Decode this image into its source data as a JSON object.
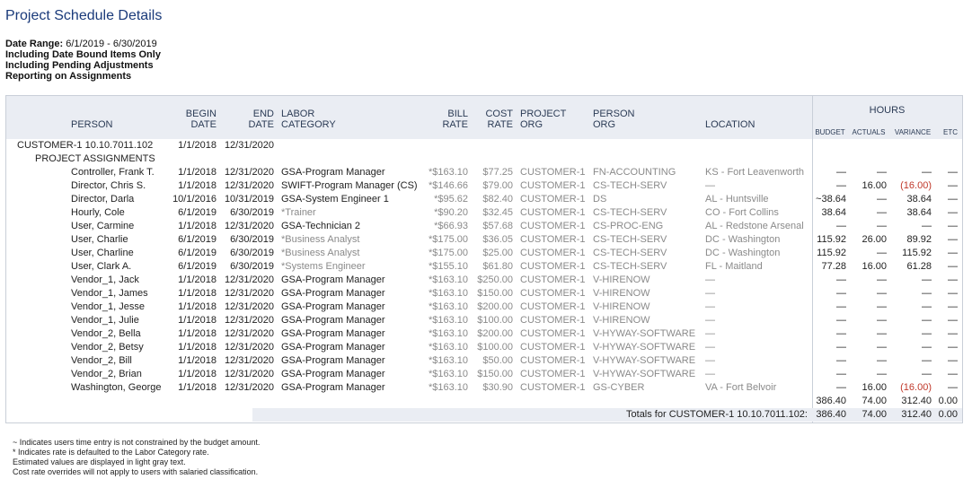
{
  "report": {
    "title": "Project Schedule Details",
    "date_range_label": "Date Range:",
    "date_range_value": "6/1/2019 - 6/30/2019",
    "option_lines": [
      "Including Date Bound Items Only",
      "Including Pending Adjustments",
      "Reporting on Assignments"
    ]
  },
  "headers": {
    "person": "PERSON",
    "begin_top": "BEGIN",
    "begin_bottom": "DATE",
    "end_top": "END",
    "end_bottom": "DATE",
    "labor_top": "LABOR",
    "labor_bottom": "CATEGORY",
    "bill_top": "BILL",
    "bill_bottom": "RATE",
    "cost_top": "COST",
    "cost_bottom": "RATE",
    "project_top": "PROJECT",
    "project_bottom": "ORG",
    "person_org_top": "PERSON",
    "person_org_bottom": "ORG",
    "location": "LOCATION",
    "hours": "HOURS",
    "budget": "BUDGET",
    "actuals": "ACTUALS",
    "variance": "VARIANCE",
    "etc": "ETC"
  },
  "customer": {
    "name": "CUSTOMER-1 10.10.7011.102",
    "begin": "1/1/2018",
    "end": "12/31/2020",
    "section_label": "PROJECT ASSIGNMENTS"
  },
  "rows": [
    {
      "person": "Controller, Frank T.",
      "begin": "1/1/2018",
      "end": "12/31/2020",
      "labor": "GSA-Program Manager",
      "bill": "*$163.10",
      "cost": "$77.25",
      "project_org": "CUSTOMER-1",
      "person_org": "FN-ACCOUNTING",
      "location": "KS - Fort Leavenworth",
      "budget": "—",
      "actuals": "—",
      "variance": "—",
      "etc": "—"
    },
    {
      "person": "Director, Chris S.",
      "begin": "1/1/2018",
      "end": "12/31/2020",
      "labor": "SWIFT-Program Manager (CS)",
      "bill": "*$146.66",
      "cost": "$79.00",
      "project_org": "CUSTOMER-1",
      "person_org": "CS-TECH-SERV",
      "location": "—",
      "budget": "—",
      "actuals": "16.00",
      "variance": "(16.00)",
      "etc": "—"
    },
    {
      "person": "Director, Darla",
      "begin": "10/1/2016",
      "end": "10/31/2019",
      "labor": "GSA-System Engineer 1",
      "bill": "*$95.62",
      "cost": "$82.40",
      "project_org": "CUSTOMER-1",
      "person_org": "DS",
      "location": "AL - Huntsville",
      "budget": "~38.64",
      "actuals": "—",
      "variance": "38.64",
      "etc": "—"
    },
    {
      "person": "Hourly, Cole",
      "begin": "6/1/2019",
      "end": "6/30/2019",
      "labor": "*Trainer",
      "bill": "*$90.20",
      "cost": "$32.45",
      "project_org": "CUSTOMER-1",
      "person_org": "CS-TECH-SERV",
      "location": "CO - Fort Collins",
      "budget": "38.64",
      "actuals": "—",
      "variance": "38.64",
      "etc": "—"
    },
    {
      "person": "User, Carmine",
      "begin": "1/1/2018",
      "end": "12/31/2020",
      "labor": "GSA-Technician 2",
      "bill": "*$66.93",
      "cost": "$57.68",
      "project_org": "CUSTOMER-1",
      "person_org": "CS-PROC-ENG",
      "location": "AL - Redstone Arsenal",
      "budget": "—",
      "actuals": "—",
      "variance": "—",
      "etc": "—"
    },
    {
      "person": "User, Charlie",
      "begin": "6/1/2019",
      "end": "6/30/2019",
      "labor": "*Business Analyst",
      "bill": "*$175.00",
      "cost": "$36.05",
      "project_org": "CUSTOMER-1",
      "person_org": "CS-TECH-SERV",
      "location": "DC - Washington",
      "budget": "115.92",
      "actuals": "26.00",
      "variance": "89.92",
      "etc": "—"
    },
    {
      "person": "User, Charline",
      "begin": "6/1/2019",
      "end": "6/30/2019",
      "labor": "*Business Analyst",
      "bill": "*$175.00",
      "cost": "$25.00",
      "project_org": "CUSTOMER-1",
      "person_org": "CS-TECH-SERV",
      "location": "DC - Washington",
      "budget": "115.92",
      "actuals": "—",
      "variance": "115.92",
      "etc": "—"
    },
    {
      "person": "User, Clark A.",
      "begin": "6/1/2019",
      "end": "6/30/2019",
      "labor": "*Systems Engineer",
      "bill": "*$155.10",
      "cost": "$61.80",
      "project_org": "CUSTOMER-1",
      "person_org": "CS-TECH-SERV",
      "location": "FL - Maitland",
      "budget": "77.28",
      "actuals": "16.00",
      "variance": "61.28",
      "etc": "—"
    },
    {
      "person": "Vendor_1, Jack",
      "begin": "1/1/2018",
      "end": "12/31/2020",
      "labor": "GSA-Program Manager",
      "bill": "*$163.10",
      "cost": "$250.00",
      "project_org": "CUSTOMER-1",
      "person_org": "V-HIRENOW",
      "location": "—",
      "budget": "—",
      "actuals": "—",
      "variance": "—",
      "etc": "—"
    },
    {
      "person": "Vendor_1, James",
      "begin": "1/1/2018",
      "end": "12/31/2020",
      "labor": "GSA-Program Manager",
      "bill": "*$163.10",
      "cost": "$150.00",
      "project_org": "CUSTOMER-1",
      "person_org": "V-HIRENOW",
      "location": "—",
      "budget": "—",
      "actuals": "—",
      "variance": "—",
      "etc": "—"
    },
    {
      "person": "Vendor_1, Jesse",
      "begin": "1/1/2018",
      "end": "12/31/2020",
      "labor": "GSA-Program Manager",
      "bill": "*$163.10",
      "cost": "$200.00",
      "project_org": "CUSTOMER-1",
      "person_org": "V-HIRENOW",
      "location": "—",
      "budget": "—",
      "actuals": "—",
      "variance": "—",
      "etc": "—"
    },
    {
      "person": "Vendor_1, Julie",
      "begin": "1/1/2018",
      "end": "12/31/2020",
      "labor": "GSA-Program Manager",
      "bill": "*$163.10",
      "cost": "$100.00",
      "project_org": "CUSTOMER-1",
      "person_org": "V-HIRENOW",
      "location": "—",
      "budget": "—",
      "actuals": "—",
      "variance": "—",
      "etc": "—"
    },
    {
      "person": "Vendor_2, Bella",
      "begin": "1/1/2018",
      "end": "12/31/2020",
      "labor": "GSA-Program Manager",
      "bill": "*$163.10",
      "cost": "$200.00",
      "project_org": "CUSTOMER-1",
      "person_org": "V-HYWAY-SOFTWARE",
      "location": "—",
      "budget": "—",
      "actuals": "—",
      "variance": "—",
      "etc": "—"
    },
    {
      "person": "Vendor_2, Betsy",
      "begin": "1/1/2018",
      "end": "12/31/2020",
      "labor": "GSA-Program Manager",
      "bill": "*$163.10",
      "cost": "$100.00",
      "project_org": "CUSTOMER-1",
      "person_org": "V-HYWAY-SOFTWARE",
      "location": "—",
      "budget": "—",
      "actuals": "—",
      "variance": "—",
      "etc": "—"
    },
    {
      "person": "Vendor_2, Bill",
      "begin": "1/1/2018",
      "end": "12/31/2020",
      "labor": "GSA-Program Manager",
      "bill": "*$163.10",
      "cost": "$50.00",
      "project_org": "CUSTOMER-1",
      "person_org": "V-HYWAY-SOFTWARE",
      "location": "—",
      "budget": "—",
      "actuals": "—",
      "variance": "—",
      "etc": "—"
    },
    {
      "person": "Vendor_2, Brian",
      "begin": "1/1/2018",
      "end": "12/31/2020",
      "labor": "GSA-Program Manager",
      "bill": "*$163.10",
      "cost": "$150.00",
      "project_org": "CUSTOMER-1",
      "person_org": "V-HYWAY-SOFTWARE",
      "location": "—",
      "budget": "—",
      "actuals": "—",
      "variance": "—",
      "etc": "—"
    },
    {
      "person": "Washington, George",
      "begin": "1/1/2018",
      "end": "12/31/2020",
      "labor": "GSA-Program Manager",
      "bill": "*$163.10",
      "cost": "$30.90",
      "project_org": "CUSTOMER-1",
      "person_org": "GS-CYBER",
      "location": "VA - Fort Belvoir",
      "budget": "—",
      "actuals": "16.00",
      "variance": "(16.00)",
      "etc": "—"
    }
  ],
  "subtotals": {
    "budget": "386.40",
    "actuals": "74.00",
    "variance": "312.40",
    "etc": "0.00"
  },
  "totals": {
    "label": "Totals for CUSTOMER-1 10.10.7011.102:",
    "budget": "386.40",
    "actuals": "74.00",
    "variance": "312.40",
    "etc": "0.00"
  },
  "footnotes": [
    "~ Indicates users time entry is not constrained by the budget amount.",
    "* Indicates rate is defaulted to the Labor Category rate.",
    "Estimated values are displayed in light gray text.",
    "Cost rate overrides will not apply to users with salaried classification."
  ]
}
